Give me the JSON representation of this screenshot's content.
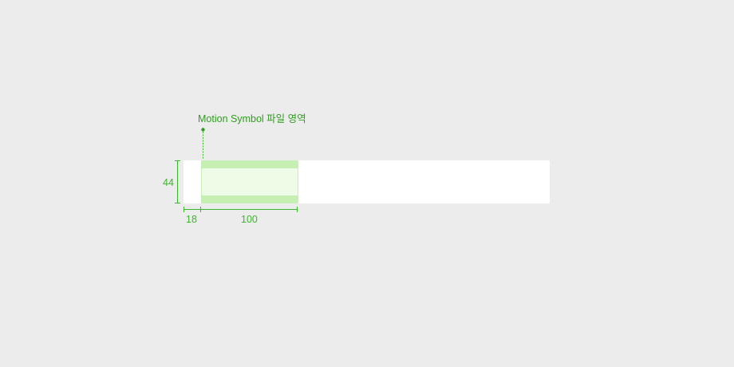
{
  "annotation": {
    "label": "Motion Symbol 파일 영역"
  },
  "dimensions": {
    "height": "44",
    "left_padding": "18",
    "symbol_width": "100"
  },
  "colors": {
    "background": "#ececec",
    "bar": "#ffffff",
    "symbol_area_fill": "#eefbe7",
    "symbol_area_band": "#c6efb4",
    "measure_line": "#3bb62a",
    "callout_text": "#2f9e1f"
  }
}
